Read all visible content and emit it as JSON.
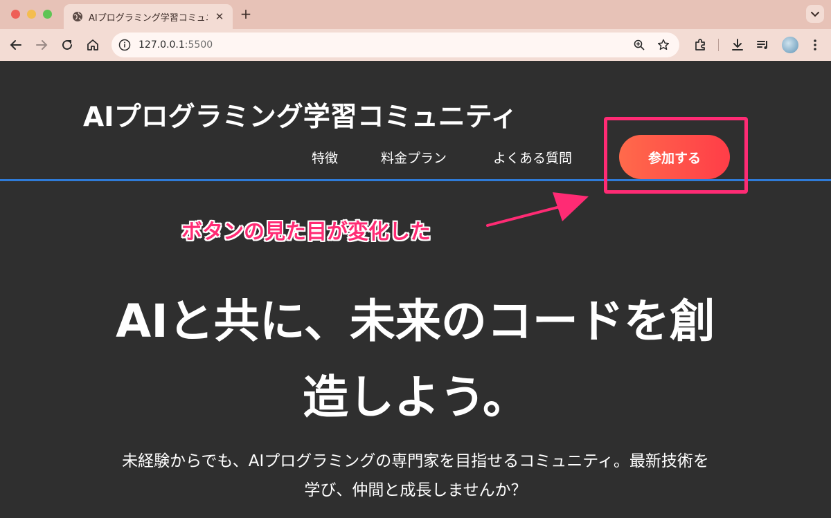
{
  "browser": {
    "tab_title": "AIプログラミング学習コミュニテ",
    "url_host": "127.0.0.1",
    "url_port": ":5500"
  },
  "site": {
    "title": "AIプログラミング学習コミュニティ",
    "nav": {
      "features": "特徴",
      "pricing": "料金プラン",
      "faq": "よくある質問",
      "join": "参加する"
    }
  },
  "annotation": {
    "text": "ボタンの見た目が変化した",
    "color": "#ff2b74"
  },
  "hero": {
    "heading_line1": "AIと共に、未来のコードを創",
    "heading_line2": "造しよう。",
    "sub_line1": "未経験からでも、AIプログラミングの専門家を目指せるコミュニティ。最新技術を",
    "sub_line2": "学び、仲間と成長しませんか？"
  },
  "colors": {
    "page_bg": "#2f2f2f",
    "divider": "#2f7bd8",
    "button_start": "#ff6a4b",
    "button_end": "#ff3d48"
  }
}
